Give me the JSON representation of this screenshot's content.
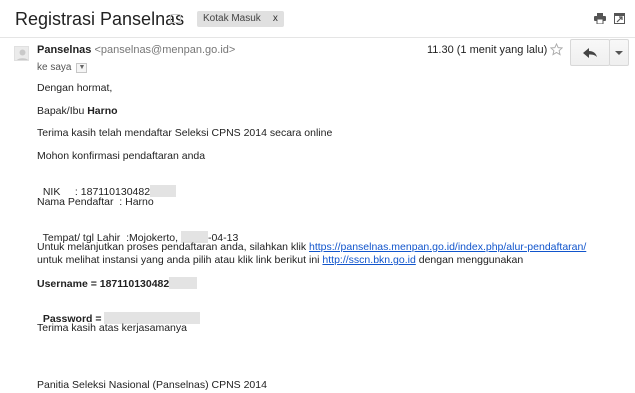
{
  "header": {
    "subject": "Registrasi Panselnas",
    "label": "Kotak Masuk",
    "label_remove": "x",
    "icons": [
      "importance-marker-icon",
      "print-icon",
      "new-window-icon"
    ]
  },
  "message": {
    "sender_name": "Panselnas",
    "sender_email": "<panselnas@menpan.go.id>",
    "recipient": "ke saya",
    "timestamp": "11.30 (1 menit yang lalu)",
    "icons": [
      "avatar",
      "star-icon",
      "reply-icon",
      "more-options-icon"
    ]
  },
  "body": {
    "greeting": "Dengan hormat,",
    "salutation": "Bapak/Ibu ",
    "name": "Harno",
    "thanks_registration": "Terima kasih telah mendaftar Seleksi CPNS 2014 secara online",
    "confirm_request": "Mohon konfirmasi pendaftaran anda",
    "nik_line": "NIK     : 187110130482",
    "registrant_line": "Nama Pendaftar  : Harno",
    "birth_prefix": "Tempat/ tgl Lahir  :Mojokerto, ",
    "birth_suffix": "-04-13",
    "continue_prefix": "Untuk melanjutkan proses pendaftaran anda, silahkan klik ",
    "continue_link": "https://panselnas.menpan.go.id/index.php/alur-pendaftaran/",
    "agency_prefix": "untuk melihat instansi yang anda pilih atau klik link berikut ini ",
    "agency_link": "http://sscn.bkn.go.id",
    "agency_suffix": " dengan menggunakan",
    "username_line": "Username = 187110130482",
    "password_line": "Password = ",
    "thanks_cooperation": "Terima kasih atas kerjasamanya",
    "signature": "Panitia Seleksi Nasional (Panselnas) CPNS 2014"
  },
  "colors": {
    "link": "#1155cc",
    "redaction": "#e3e3e3",
    "text": "#222222"
  }
}
